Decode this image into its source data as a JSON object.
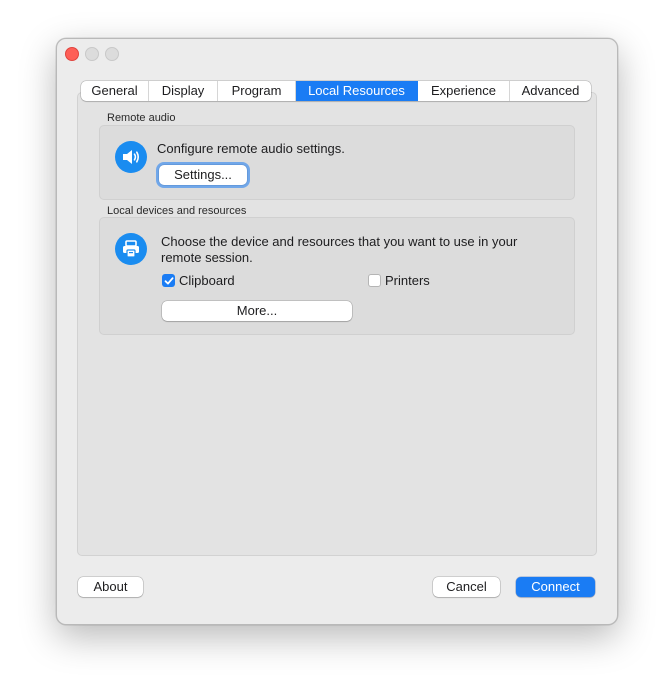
{
  "window": {
    "controls": [
      "close",
      "minimize",
      "maximize"
    ]
  },
  "tabs": [
    {
      "label": "General",
      "active": false
    },
    {
      "label": "Display",
      "active": false
    },
    {
      "label": "Program",
      "active": false
    },
    {
      "label": "Local Resources",
      "active": true
    },
    {
      "label": "Experience",
      "active": false
    },
    {
      "label": "Advanced",
      "active": false
    }
  ],
  "remote_audio": {
    "group_label": "Remote audio",
    "icon": "speaker-icon",
    "description": "Configure remote audio settings.",
    "settings_button": "Settings..."
  },
  "local_devices": {
    "group_label": "Local devices and resources",
    "icon": "devices-icon",
    "description_line1": "Choose the device and resources that you want to use in your",
    "description_line2": "remote session.",
    "clipboard": {
      "label": "Clipboard",
      "checked": true
    },
    "printers": {
      "label": "Printers",
      "checked": false
    },
    "more_button": "More..."
  },
  "footer": {
    "about_button": "About",
    "cancel_button": "Cancel",
    "connect_button": "Connect"
  },
  "colors": {
    "accent": "#1a7cf4",
    "close": "#fe5f57"
  }
}
